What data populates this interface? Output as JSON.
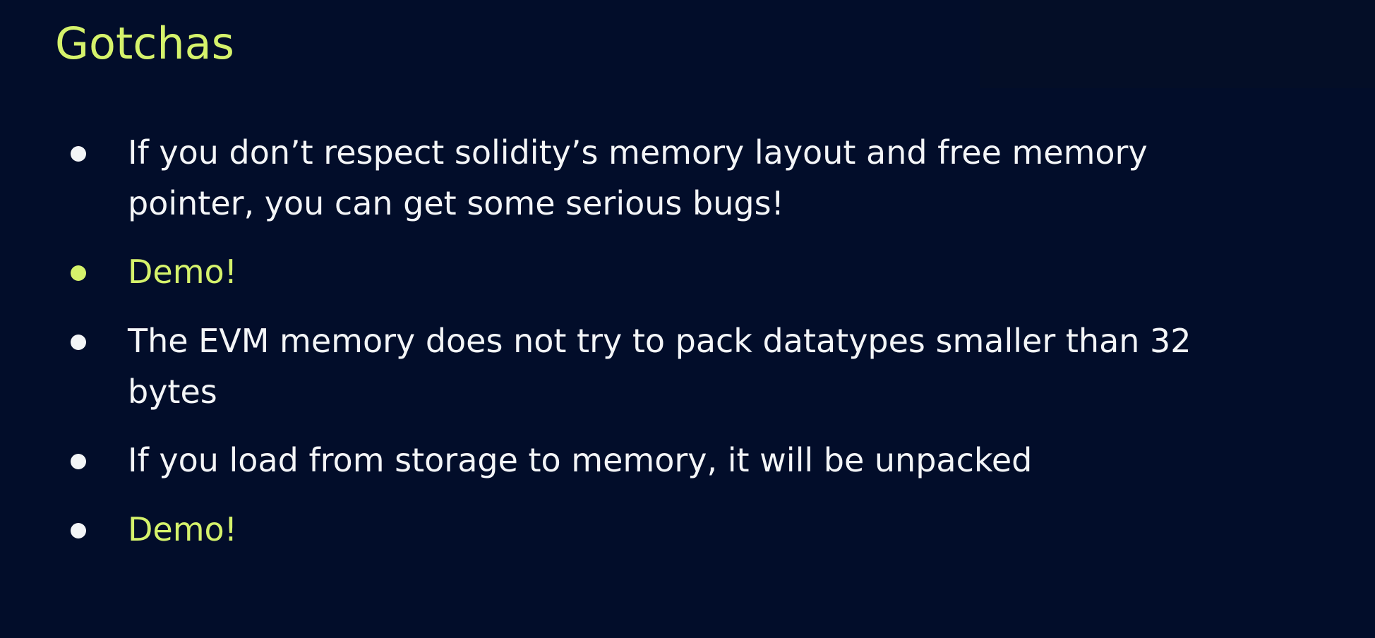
{
  "slide": {
    "title": "Gotchas",
    "colors": {
      "background": "#020d2a",
      "accent": "#d5f26b",
      "text": "#f3f5f7"
    },
    "bullets": [
      {
        "lines": [
          "If you don’t respect solidity’s memory layout and free memory",
          "pointer, you can get some serious bugs!"
        ]
      },
      {
        "lines": [
          "Demo!"
        ]
      },
      {
        "lines": [
          "The EVM memory does not try to pack datatypes smaller than 32",
          "bytes"
        ]
      },
      {
        "lines": [
          "If you load from storage to memory, it will be unpacked"
        ]
      },
      {
        "lines": [
          "Demo!"
        ]
      }
    ]
  }
}
